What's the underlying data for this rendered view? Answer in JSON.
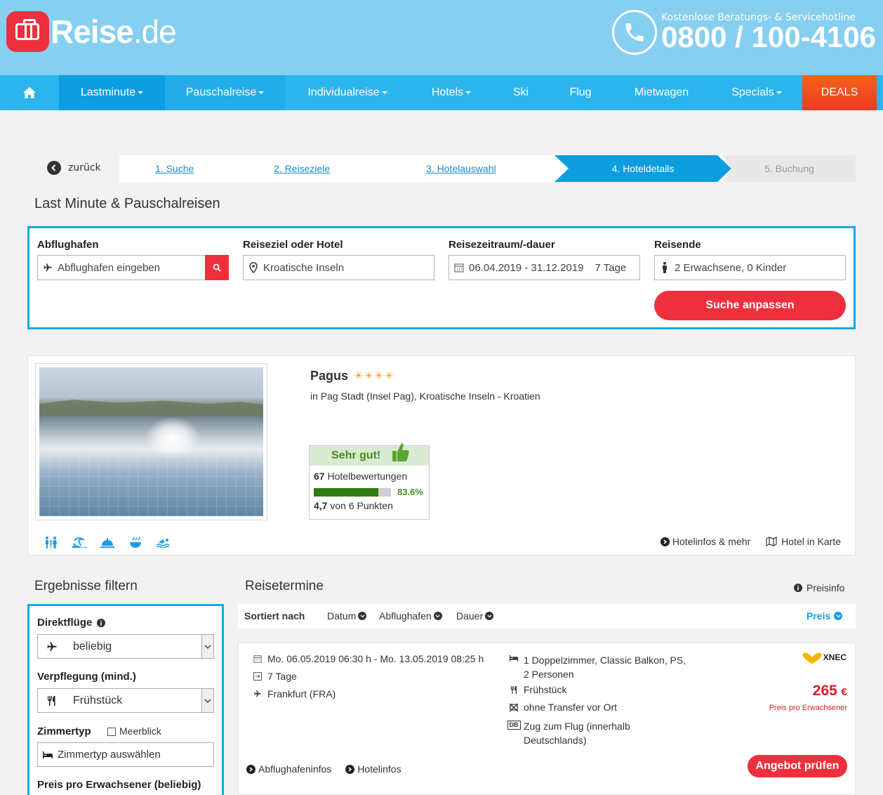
{
  "header": {
    "logo_main": "Reise",
    "logo_tld": ".de",
    "hotline_label": "Kostenlose Beratungs- & Servicehotline",
    "hotline_number": "0800 / 100-4106"
  },
  "nav": {
    "items": [
      {
        "label": "Lastminute",
        "caret": true
      },
      {
        "label": "Pauschalreise",
        "caret": true
      },
      {
        "label": "Individualreise",
        "caret": true
      },
      {
        "label": "Hotels",
        "caret": true
      },
      {
        "label": "Ski",
        "caret": false
      },
      {
        "label": "Flug",
        "caret": false
      },
      {
        "label": "Mietwagen",
        "caret": false
      },
      {
        "label": "Specials",
        "caret": true
      }
    ],
    "deals": "DEALS"
  },
  "breadcrumb": {
    "back": "zurück",
    "steps": [
      "1. Suche",
      "2. Reiseziele",
      "3. Hotelauswahl",
      "4. Hoteldetails",
      "5. Buchung"
    ]
  },
  "page_title": "Last Minute & Pauschalreisen",
  "search": {
    "departure_label": "Abflughafen",
    "departure_placeholder": "Abflughafen eingeben",
    "destination_label": "Reiseziel oder Hotel",
    "destination_value": "Kroatische Inseln",
    "period_label": "Reisezeitraum/-dauer",
    "period_value": "06.04.2019 - 31.12.2019",
    "duration_value": "7 Tage",
    "travelers_label": "Reisende",
    "travelers_value": "2 Erwachsene, 0 Kinder",
    "submit": "Suche anpassen"
  },
  "hotel": {
    "name": "Pagus",
    "stars": 4,
    "location": "in Pag Stadt (Insel Pag), Kroatische Inseln - Kroatien",
    "rating_label": "Sehr gut!",
    "review_count": "67",
    "review_text": "Hotelbewertungen",
    "rating_percent": 83.6,
    "rating_percent_text": "83.6%",
    "score": "4,7",
    "score_text": "von 6 Punkten",
    "link_info": "Hotelinfos & mehr",
    "link_map": "Hotel in Karte"
  },
  "filter": {
    "title": "Ergebnisse filtern",
    "direct_label": "Direktflüge",
    "direct_value": "beliebig",
    "board_label": "Verpflegung (mind.)",
    "board_value": "Frühstück",
    "room_label": "Zimmertyp",
    "seaview_label": "Meerblick",
    "room_placeholder": "Zimmertyp auswählen",
    "price_label": "Preis pro Erwachsener (beliebig)"
  },
  "results": {
    "title": "Reisetermine",
    "price_info": "Preisinfo",
    "sort_label": "Sortiert nach",
    "sort_options": [
      "Datum",
      "Abflughafen",
      "Dauer"
    ],
    "sort_active": "Preis",
    "offer": {
      "dates": "Mo. 06.05.2019 06:30 h - Mo. 13.05.2019 08:25 h",
      "duration": "7 Tage",
      "airport": "Frankfurt (FRA)",
      "room_line1": "1 Doppelzimmer, Classic Balkon, PS,",
      "room_line2": "2 Personen",
      "board": "Frühstück",
      "transfer": "ohne Transfer vor Ort",
      "train_line1": "Zug zum Flug (innerhalb",
      "train_line2": "Deutschlands)",
      "db_badge": "DB",
      "operator": "XNEC",
      "price": "265",
      "currency": "€",
      "price_note": "Preis pro Erwachsener",
      "cta": "Angebot prüfen",
      "link_airport": "Abflughafeninfos",
      "link_hotel": "Hotelinfos"
    }
  }
}
